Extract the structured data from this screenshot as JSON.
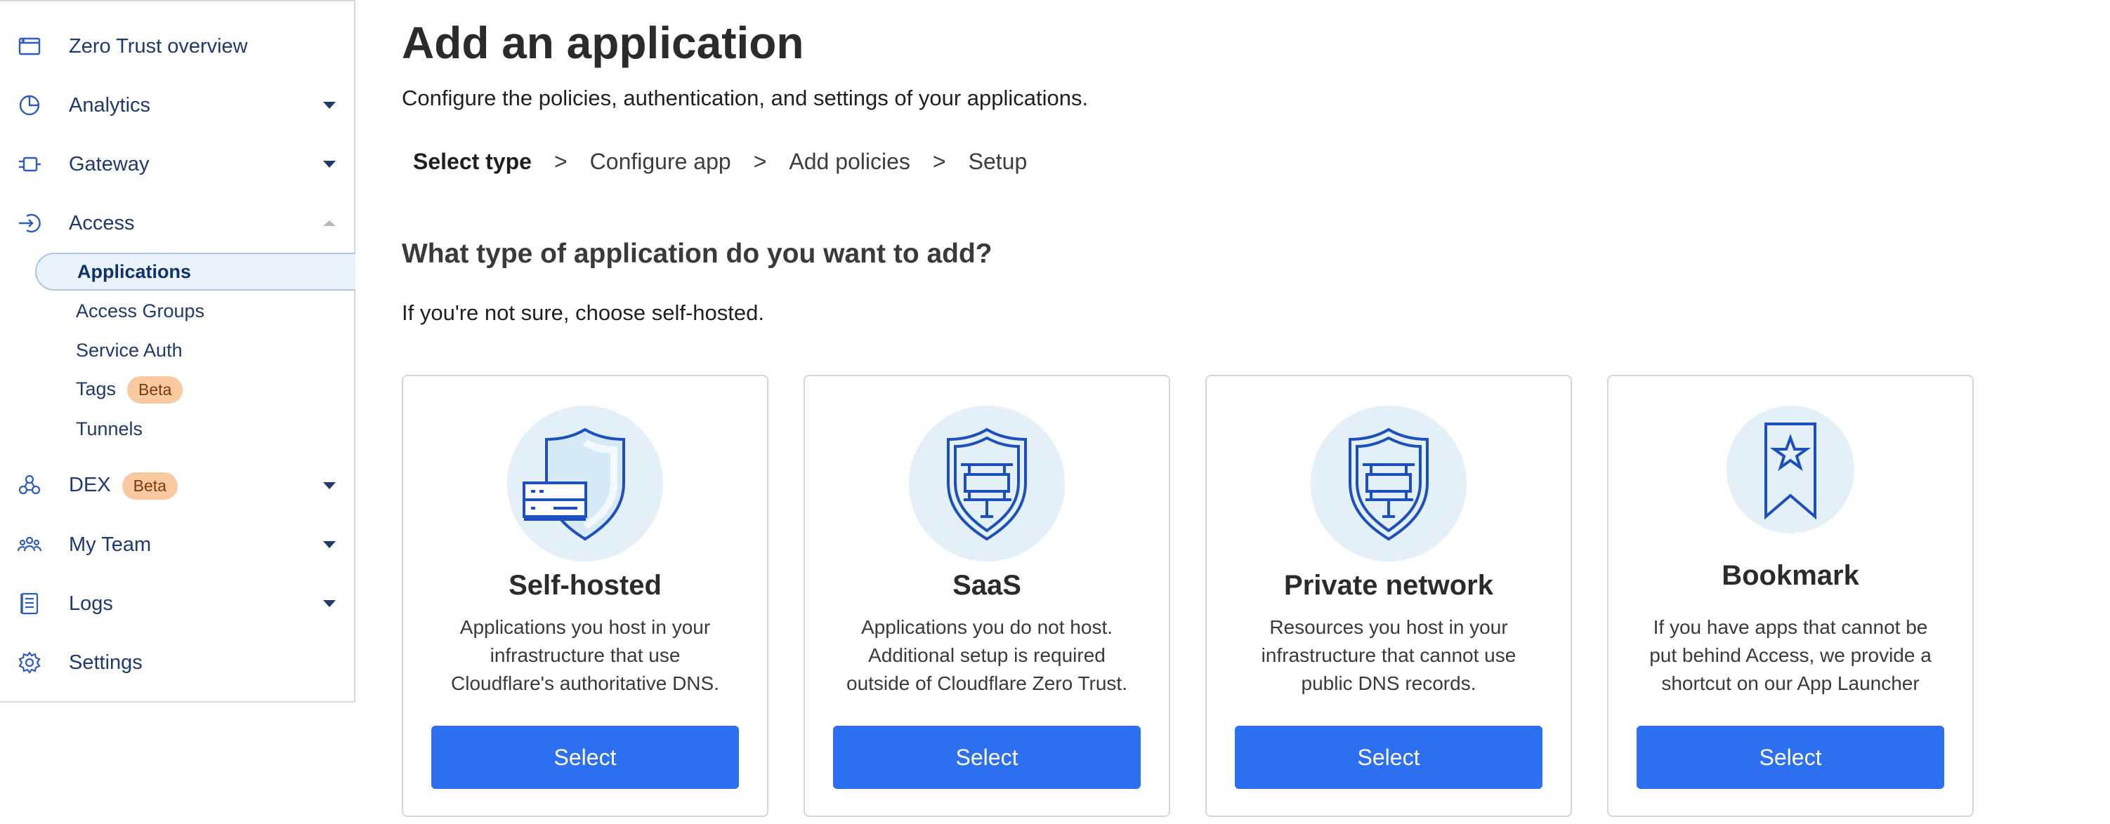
{
  "sidebar": {
    "items": [
      {
        "label": "Zero Trust overview"
      },
      {
        "label": "Analytics"
      },
      {
        "label": "Gateway"
      },
      {
        "label": "Access"
      },
      {
        "label": "DEX",
        "badge": "Beta"
      },
      {
        "label": "My Team"
      },
      {
        "label": "Logs"
      },
      {
        "label": "Settings"
      }
    ],
    "access_sub": [
      {
        "label": "Applications"
      },
      {
        "label": "Access Groups"
      },
      {
        "label": "Service Auth"
      },
      {
        "label": "Tags",
        "badge": "Beta"
      },
      {
        "label": "Tunnels"
      }
    ]
  },
  "main": {
    "title": "Add an application",
    "subtitle": "Configure the policies, authentication, and settings of your applications.",
    "steps": [
      "Select type",
      "Configure app",
      "Add policies",
      "Setup"
    ],
    "step_separator": ">",
    "question": "What type of application do you want to add?",
    "hint": "If you're not sure, choose self-hosted.",
    "cards": [
      {
        "title": "Self-hosted",
        "desc": [
          "Applications you host in your",
          "infrastructure that use",
          "Cloudflare's authoritative DNS."
        ],
        "button": "Select",
        "icon": "shield-server-icon"
      },
      {
        "title": "SaaS",
        "desc": [
          "Applications you do not host.",
          "Additional setup is required",
          "outside of Cloudflare Zero Trust."
        ],
        "button": "Select",
        "icon": "shield-network-icon"
      },
      {
        "title": "Private network",
        "desc": [
          "Resources you host in your",
          "infrastructure that cannot use",
          "public DNS records."
        ],
        "button": "Select",
        "icon": "shield-network-icon"
      },
      {
        "title": "Bookmark",
        "desc": [
          "If you have apps that cannot be",
          "put behind Access, we provide a",
          "shortcut on our App Launcher"
        ],
        "button": "Select",
        "icon": "bookmark-star-icon"
      }
    ]
  },
  "colors": {
    "accent": "#2c6ff0",
    "nav_text": "#1e3a6e",
    "badge_bg": "#f9c9a0",
    "icon_bg": "#e3f0f8",
    "icon_stroke": "#1d4fbf"
  }
}
